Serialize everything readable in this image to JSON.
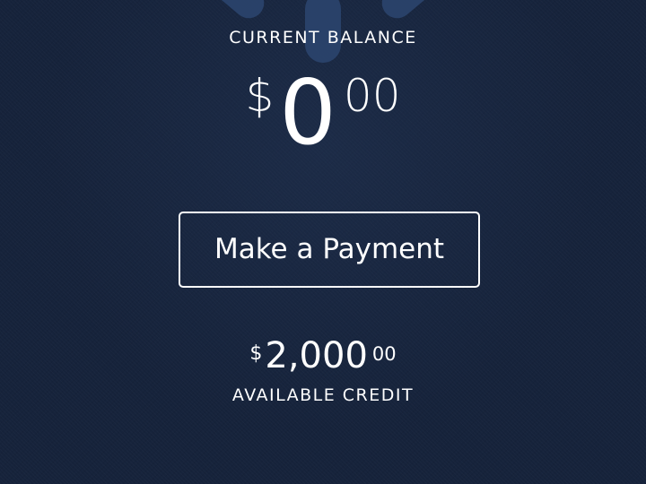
{
  "balance": {
    "label": "CURRENT BALANCE",
    "currency_symbol": "$",
    "whole": "0",
    "cents": "00"
  },
  "actions": {
    "make_payment_label": "Make a Payment"
  },
  "credit": {
    "currency_symbol": "$",
    "whole": "2,000",
    "cents": "00",
    "label": "AVAILABLE CREDIT"
  },
  "icons": {
    "logo": "spark-logo-icon"
  },
  "colors": {
    "background": "#16233b",
    "text": "#ffffff",
    "logo": "#2c4670"
  }
}
